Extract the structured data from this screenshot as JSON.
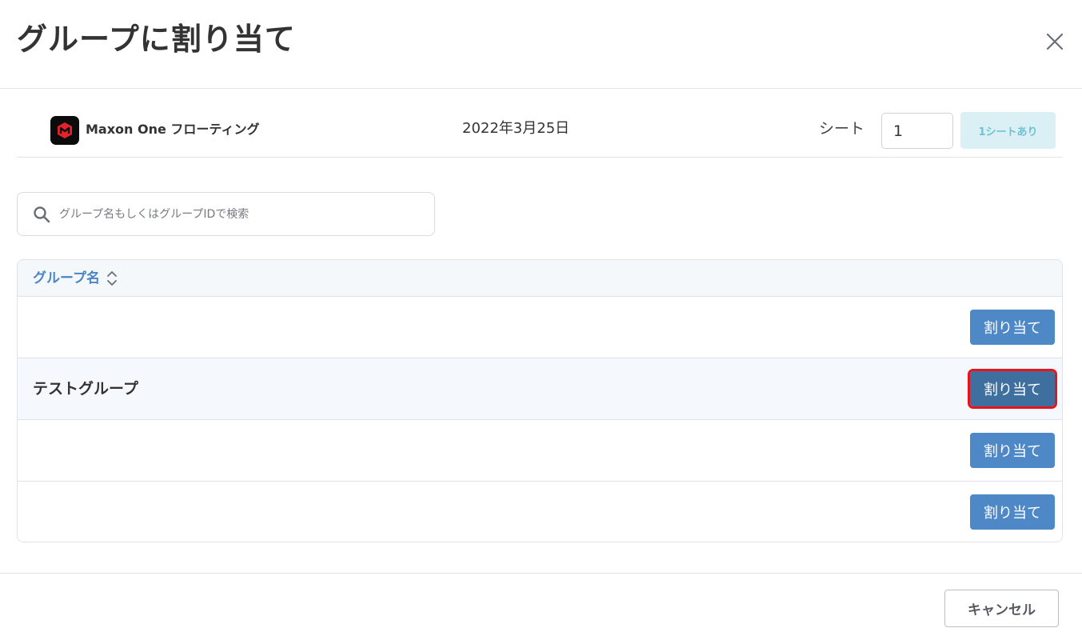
{
  "dialog": {
    "title": "グループに割り当て",
    "close_icon": "close-icon"
  },
  "product": {
    "icon": "maxon-logo",
    "name": "Maxon One フローティング",
    "date": "2022年3月25日",
    "seat_label": "シート",
    "seat_value": "1",
    "seat_badge": "1シートあり",
    "brand_color": "#e52229"
  },
  "search": {
    "icon": "search-icon",
    "placeholder": "グループ名もしくはグループIDで検索",
    "value": ""
  },
  "table": {
    "column_header": "グループ名",
    "sort_icon": "sort-icon",
    "rows": [
      {
        "name": "",
        "action": "割り当て"
      },
      {
        "name": "テストグループ",
        "action": "割り当て"
      },
      {
        "name": "",
        "action": "割り当て"
      },
      {
        "name": "",
        "action": "割り当て"
      }
    ]
  },
  "footer": {
    "cancel_label": "キャンセル"
  },
  "colors": {
    "accent": "#4e88c7",
    "highlight_outline": "#e8141b",
    "badge_bg": "#dbf0f5",
    "badge_text": "#6fc1d6"
  }
}
